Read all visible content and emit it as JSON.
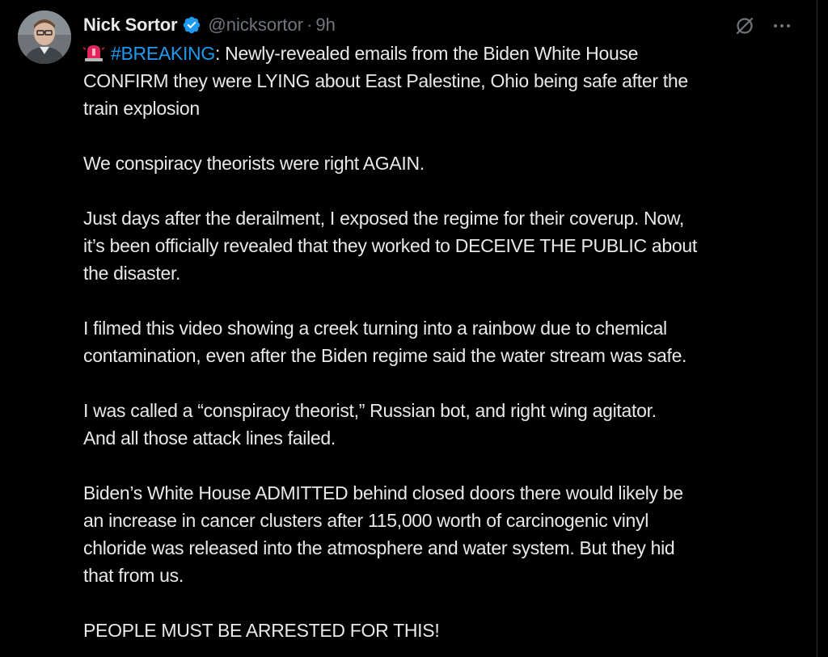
{
  "author": {
    "name": "Nick Sortor",
    "handle": "@nicksortor",
    "separator": "·",
    "time": "9h",
    "verified_icon": "verified-badge-icon",
    "avatar": "avatar-photo"
  },
  "actions": {
    "grok_icon": "grok-icon",
    "more_icon": "more-options-icon"
  },
  "colors": {
    "background": "#000000",
    "text": "#e7e9ea",
    "secondary": "#71767b",
    "accent": "#1d9bf0",
    "siren": "#e0245e"
  },
  "tweet": {
    "emoji": "police-siren-emoji",
    "hashtag": "#BREAKING",
    "paragraphs": [
      {
        "lines": [
          ": Newly-revealed emails from the Biden White House",
          "CONFIRM they were LYING about East Palestine, Ohio being safe after the",
          "train explosion"
        ]
      },
      {
        "lines": [
          "We conspiracy theorists were right AGAIN."
        ]
      },
      {
        "lines": [
          "Just days after the derailment, I exposed the regime for their coverup. Now,",
          "it’s been officially revealed that they worked to DECEIVE THE PUBLIC about",
          "the disaster."
        ]
      },
      {
        "lines": [
          "I filmed this video showing a creek turning into a rainbow due to chemical",
          "contamination, even after the Biden regime said the water stream was safe."
        ]
      },
      {
        "lines": [
          "I was called a “conspiracy theorist,” Russian bot, and right wing agitator.",
          "And all those attack lines failed."
        ]
      },
      {
        "lines": [
          "Biden’s White House ADMITTED behind closed doors there would likely be",
          "an increase in cancer clusters after 115,000 worth of carcinogenic vinyl",
          "chloride was released into the atmosphere and water system. But they hid",
          "that from us."
        ]
      },
      {
        "lines": [
          "PEOPLE MUST BE ARRESTED FOR THIS!"
        ]
      }
    ]
  }
}
